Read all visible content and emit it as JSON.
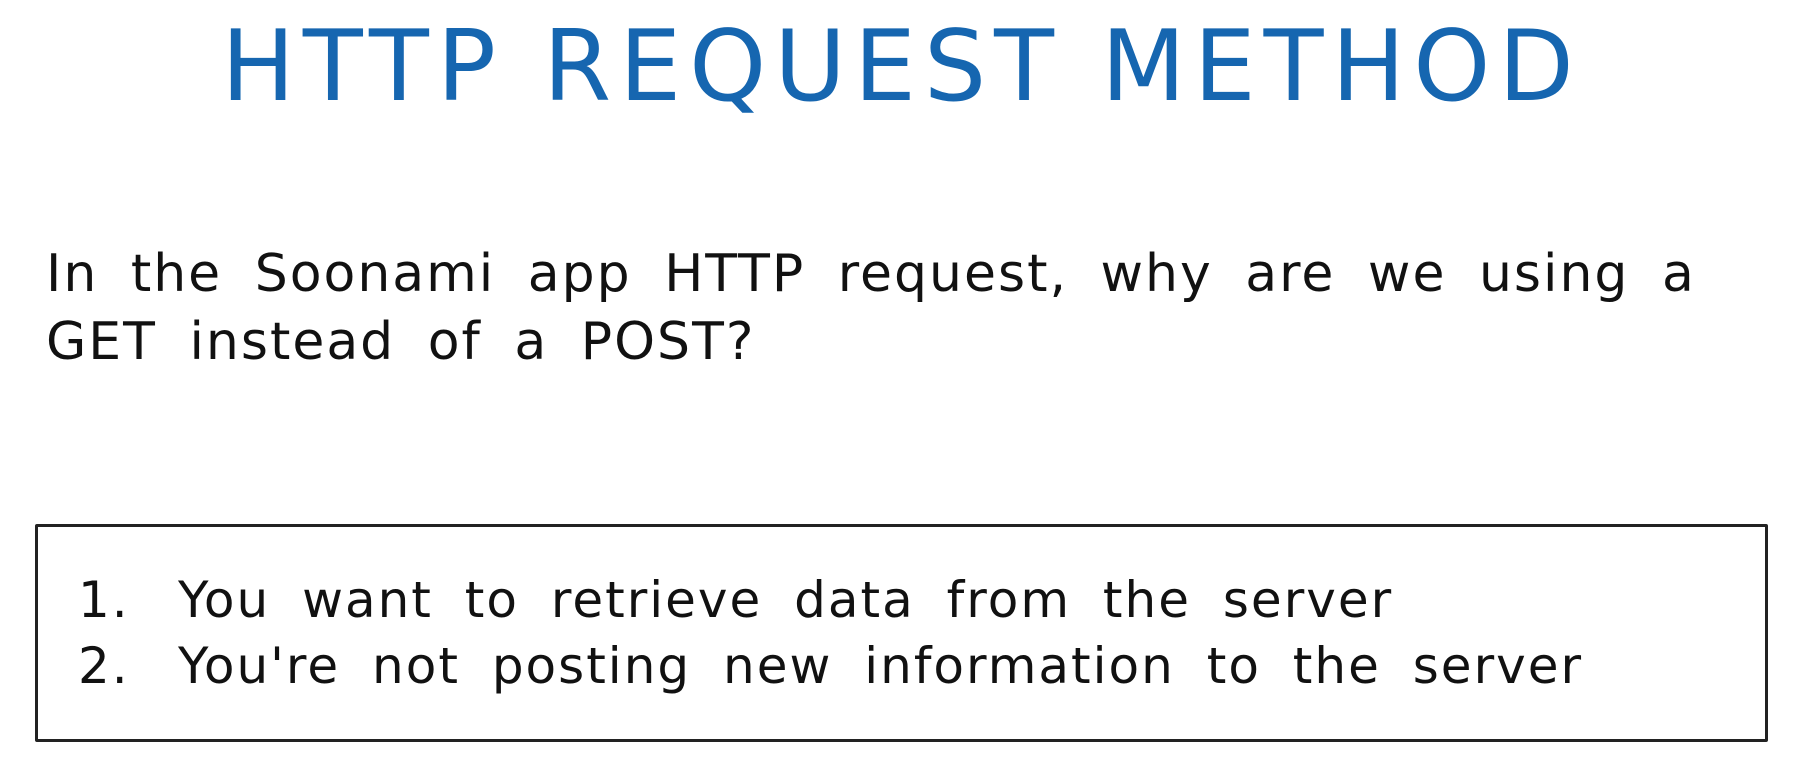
{
  "title": "HTTP REQUEST METHOD",
  "question": "In the Soonami app HTTP request, why are we using a GET instead of a POST?",
  "answers": [
    {
      "number": "1.",
      "text": "You want to retrieve data from the server"
    },
    {
      "number": "2.",
      "text": "You're not posting new information to the server"
    }
  ],
  "colors": {
    "title": "#1666b0",
    "text": "#111111",
    "box_border": "#222222",
    "background": "#ffffff"
  }
}
